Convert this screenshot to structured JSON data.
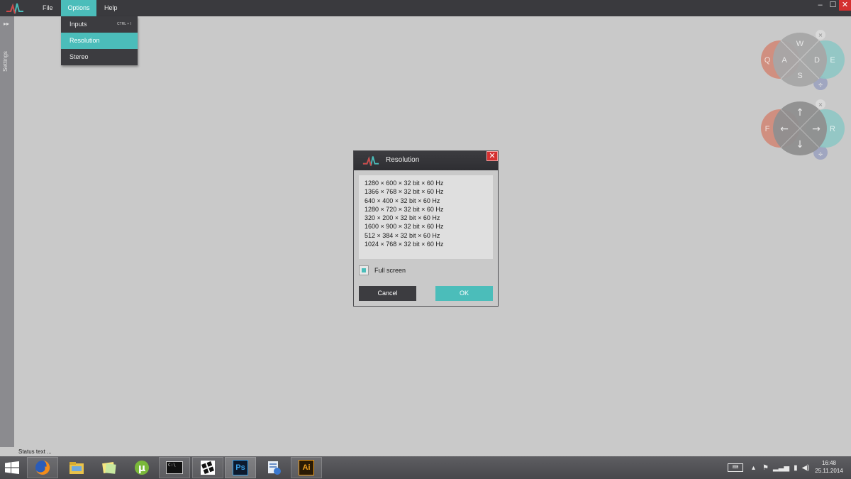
{
  "menubar": {
    "file": "File",
    "options": "Options",
    "help": "Help"
  },
  "options_menu": [
    {
      "label": "Inputs",
      "shortcut": "CTRL + I"
    },
    {
      "label": "Resolution",
      "shortcut": ""
    },
    {
      "label": "Stereo",
      "shortcut": ""
    }
  ],
  "sidebar": {
    "label": "Settings"
  },
  "pads": {
    "top": {
      "up": "W",
      "left": "A",
      "right": "D",
      "down": "S",
      "far_left": "Q",
      "far_right": "E"
    },
    "bottom": {
      "far_left": "F",
      "far_right": "R"
    }
  },
  "dialog": {
    "title": "Resolution",
    "resolutions": [
      "1280 × 600 × 32 bit × 60 Hz",
      "1366 × 768 × 32 bit × 60 Hz",
      "640 × 400 × 32 bit × 60 Hz",
      "1280 × 720 × 32 bit × 60 Hz",
      "320 × 200 × 32 bit × 60 Hz",
      "1600 × 900 × 32 bit × 60 Hz",
      "512 × 384 × 32 bit × 60 Hz",
      "1024 × 768 × 32 bit × 60 Hz"
    ],
    "fullscreen_label": "Full screen",
    "fullscreen_checked": true,
    "cancel": "Cancel",
    "ok": "OK"
  },
  "status": {
    "text": "Status text ..."
  },
  "taskbar": {
    "apps": [
      "firefox-icon",
      "file-explorer-icon",
      "sticky-notes-icon",
      "utorrent-icon",
      "command-prompt-icon",
      "windows-app-icon",
      "photoshop-icon",
      "control-panel-icon",
      "illustrator-icon"
    ],
    "ps_label": "Ps",
    "ai_label": "Ai",
    "cmd_label": "C:\\",
    "time": "16:48",
    "date": "25.11.2014"
  },
  "colors": {
    "accent": "#4bbdba",
    "dark": "#3c3c40",
    "close_red": "#d43030",
    "pad_red": "#d08878",
    "pad_teal": "#8ec7c4"
  }
}
